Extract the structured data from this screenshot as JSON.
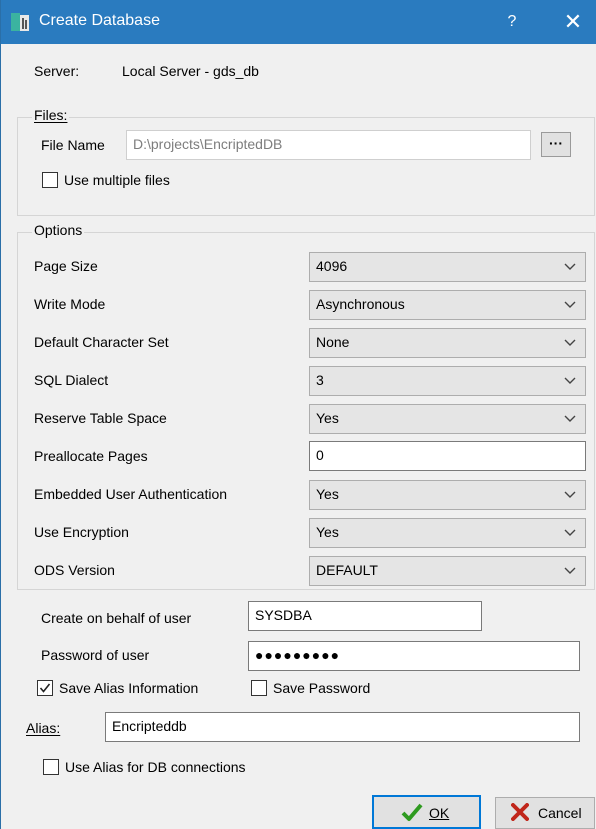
{
  "window": {
    "title": "Create Database",
    "help_label": "?",
    "close_label": "✕"
  },
  "server": {
    "label": "Server:",
    "value": "Local Server - gds_db"
  },
  "files": {
    "legend": "Files:",
    "file_name_label": "File Name",
    "file_name_value": "D:\\projects\\EncriptedDB",
    "browse_label": "···",
    "use_multiple_label": "Use multiple files",
    "use_multiple_checked": false
  },
  "options": {
    "legend": "Options",
    "rows": [
      {
        "label": "Page Size",
        "value": "4096",
        "type": "combo"
      },
      {
        "label": "Write Mode",
        "value": "Asynchronous",
        "type": "combo"
      },
      {
        "label": "Default Character Set",
        "value": "None",
        "type": "combo"
      },
      {
        "label": "SQL Dialect",
        "value": "3",
        "type": "combo"
      },
      {
        "label": "Reserve Table Space",
        "value": "Yes",
        "type": "combo"
      },
      {
        "label": "Preallocate Pages",
        "value": "0",
        "type": "text"
      },
      {
        "label": "Embedded User Authentication",
        "value": "Yes",
        "type": "combo"
      },
      {
        "label": "Use Encryption",
        "value": "Yes",
        "type": "combo"
      },
      {
        "label": "ODS Version",
        "value": "DEFAULT",
        "type": "combo"
      }
    ]
  },
  "user": {
    "behalf_label": "Create on behalf of user",
    "behalf_value": "SYSDBA",
    "password_label": "Password of user",
    "password_value": "●●●●●●●●●"
  },
  "alias": {
    "save_alias_label": "Save Alias Information",
    "save_alias_checked": true,
    "save_password_label": "Save Password",
    "save_password_checked": false,
    "alias_label": "Alias:",
    "alias_value": "Encripteddb",
    "use_alias_label": "Use Alias for DB connections",
    "use_alias_checked": false
  },
  "buttons": {
    "ok_label": "OK",
    "cancel_label": "Cancel"
  },
  "colors": {
    "titlebar": "#2a7bbf",
    "ok_check": "#2e9a1f",
    "cancel_x": "#c0261a"
  }
}
